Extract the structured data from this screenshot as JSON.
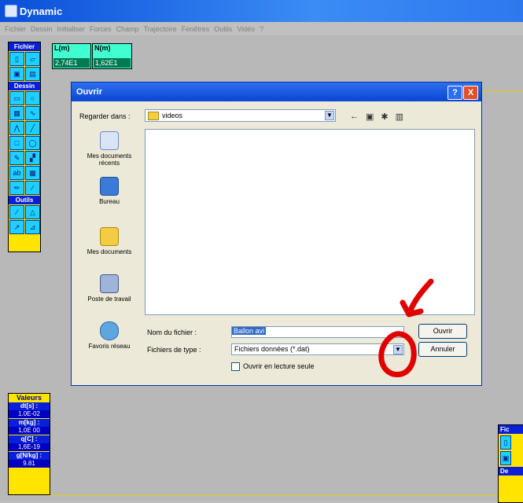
{
  "app": {
    "title": "Dynamic"
  },
  "menu": [
    "Fichier",
    "Dessin",
    "Initialiser",
    "Forces",
    "Champ",
    "Trajectoire",
    "Fenêtres",
    "Outils",
    "Vidéo",
    "?"
  ],
  "toolbar": {
    "sections": [
      "Fichier",
      "Dessin",
      "Outils"
    ]
  },
  "readouts": [
    {
      "label": "L(m)",
      "value": "2,74E1"
    },
    {
      "label": "N(m)",
      "value": "1,62E1"
    }
  ],
  "values_panel": {
    "title": "Valeurs",
    "items": [
      {
        "label": "dt[s] :",
        "value": "1.0E-02"
      },
      {
        "label": "m[kg] :",
        "value": "1,0E 00"
      },
      {
        "label": "q[C] :",
        "value": "1,6E-19"
      },
      {
        "label": "g[N/kg] :",
        "value": "9.81"
      }
    ]
  },
  "mini_toolbar": {
    "labels": [
      "Fic",
      "De"
    ]
  },
  "dialog": {
    "title": "Ouvrir",
    "help": "?",
    "close": "X",
    "look_in_label": "Regarder dans :",
    "look_in_value": "videos",
    "places": [
      "Mes documents récents",
      "Bureau",
      "Mes documents",
      "Poste de travail",
      "Favoris réseau"
    ],
    "filename_label": "Nom du fichier :",
    "filename_value": "Ballon avi",
    "filetype_label": "Fichiers de type :",
    "filetype_value": "Fichiers données (*.dat)",
    "readonly_label": "Ouvrir en lecture seule",
    "open_button": "Ouvrir",
    "cancel_button": "Annuler"
  },
  "colors": {
    "annotation": "#e00000",
    "accent": "#0a46d2",
    "panel": "#ffe400"
  }
}
